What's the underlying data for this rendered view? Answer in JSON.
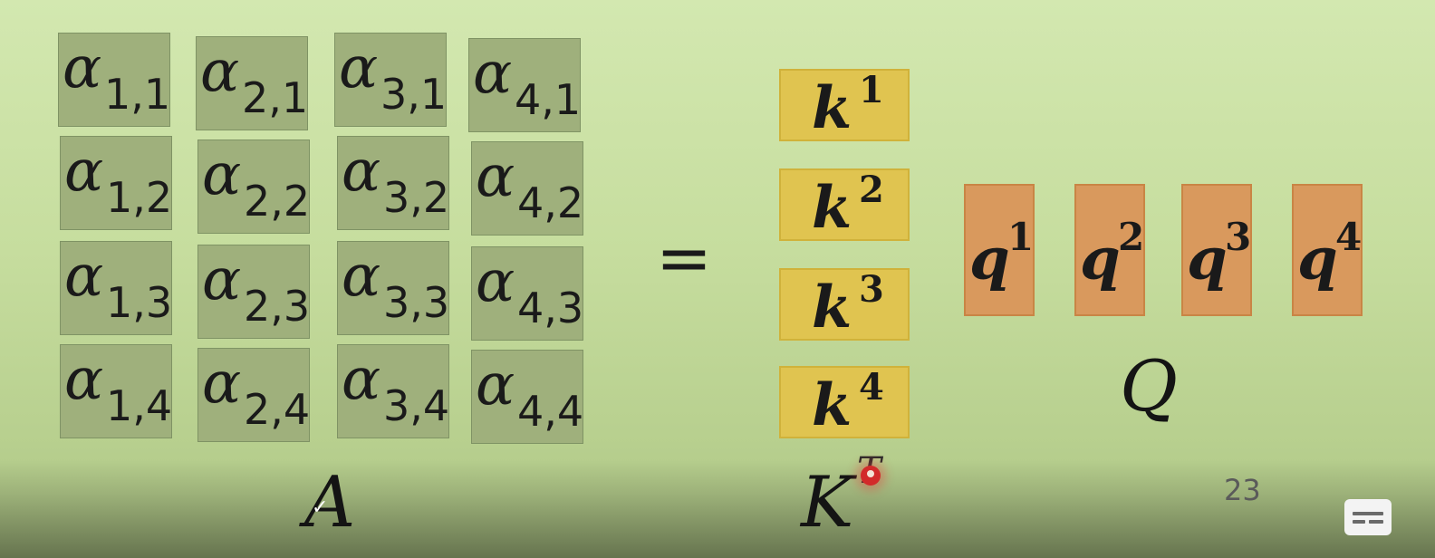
{
  "matrix_A": {
    "symbol": "α",
    "rows": [
      [
        "1,1",
        "2,1",
        "3,1",
        "4,1"
      ],
      [
        "1,2",
        "2,2",
        "3,2",
        "4,2"
      ],
      [
        "1,3",
        "2,3",
        "3,3",
        "4,3"
      ],
      [
        "1,4",
        "2,4",
        "3,4",
        "4,4"
      ]
    ],
    "label": "A"
  },
  "equals_sign": "=",
  "keys": {
    "symbol": "k",
    "superscripts": [
      "1",
      "2",
      "3",
      "4"
    ],
    "label": "K",
    "transpose_mark": "T"
  },
  "queries": {
    "symbol": "q",
    "superscripts": [
      "1",
      "2",
      "3",
      "4"
    ],
    "label": "Q"
  },
  "slide_number": "23",
  "player": {
    "captions_icon": "closed-captions-icon",
    "checkmark_icon": "checkmark-icon",
    "cursor_icon": "laser-pointer-icon"
  },
  "colors": {
    "background": "#cfe4ab",
    "matrix_cell": "#9fb07c",
    "key_box": "#e0c450",
    "query_box": "#d9995d"
  }
}
